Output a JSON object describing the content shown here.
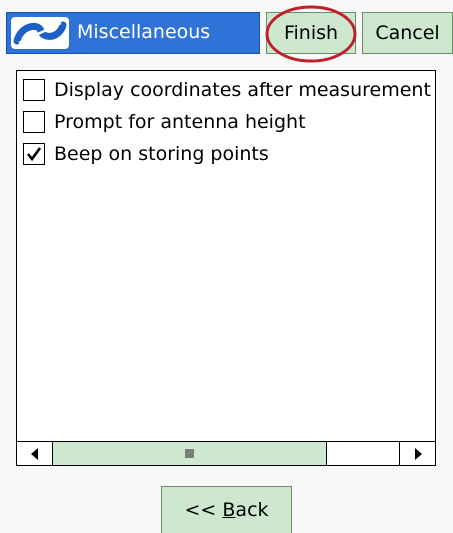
{
  "title_bar": {
    "title": "Miscellaneous",
    "logo_icon": "app-logo-icon",
    "finish_label": "Finish",
    "cancel_label": "Cancel"
  },
  "options": [
    {
      "label": "Display coordinates after measurement",
      "checked": false
    },
    {
      "label": "Prompt for antenna height",
      "checked": false
    },
    {
      "label": "Beep on storing points",
      "checked": true
    }
  ],
  "scrollbar": {
    "left_icon": "arrow-left-icon",
    "right_icon": "arrow-right-icon"
  },
  "footer": {
    "back_prefix": "<< ",
    "back_mnemonic": "B",
    "back_rest": "ack"
  },
  "colors": {
    "title_blue": "#2f72d8",
    "button_green": "#cde8cf",
    "highlight_red": "#c0202a"
  }
}
